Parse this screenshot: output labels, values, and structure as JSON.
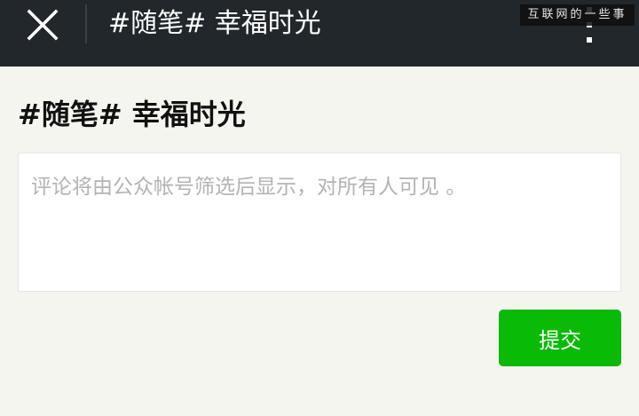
{
  "topbar": {
    "title": "#随笔# 幸福时光",
    "watermark": "互联网的一些事",
    "close_icon": "close-icon",
    "more_icon": "more-vertical-icon"
  },
  "article": {
    "title": "#随笔# 幸福时光"
  },
  "comment": {
    "placeholder": "评论将由公众帐号筛选后显示，对所有人可见 。",
    "submit_label": "提交"
  },
  "colors": {
    "topbar_bg": "#22272b",
    "page_bg": "#f5f5f0",
    "submit_bg": "#09bb07",
    "placeholder_text": "#b3b3b3"
  }
}
